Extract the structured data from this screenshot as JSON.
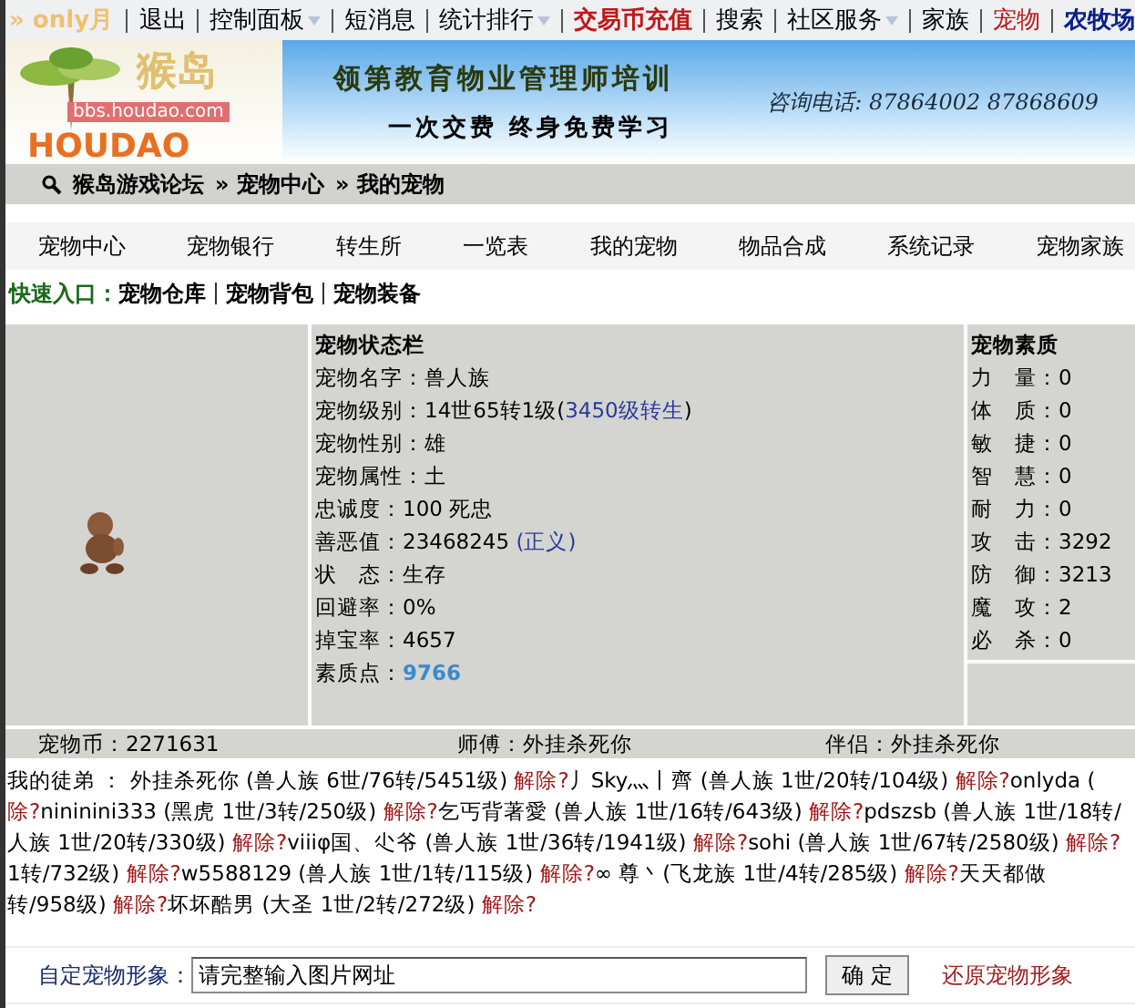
{
  "top_nav": {
    "user": "» only月",
    "items": [
      {
        "label": "退出",
        "kind": "plain",
        "dropdown": false
      },
      {
        "label": "控制面板",
        "kind": "plain",
        "dropdown": true
      },
      {
        "label": "短消息",
        "kind": "plain",
        "dropdown": false
      },
      {
        "label": "统计排行",
        "kind": "plain",
        "dropdown": true
      },
      {
        "label": "交易币充值",
        "kind": "hot",
        "dropdown": false
      },
      {
        "label": "搜索",
        "kind": "plain",
        "dropdown": false
      },
      {
        "label": "社区服务",
        "kind": "plain",
        "dropdown": true
      },
      {
        "label": "家族",
        "kind": "plain",
        "dropdown": false
      },
      {
        "label": "宠物",
        "kind": "red",
        "dropdown": false
      },
      {
        "label": "农牧场",
        "kind": "blue",
        "dropdown": false
      }
    ]
  },
  "logo": {
    "title": "猴岛",
    "url": "bbs.houdao.com",
    "wordmark": "HOUDAO"
  },
  "banner": {
    "headline": "领第教育物业管理师培训",
    "subline": "一次交费 终身免费学习",
    "phone": "咨询电话: 87864002 87868609"
  },
  "breadcrumb": [
    "猴岛游戏论坛",
    "» 宠物中心",
    "» 我的宠物"
  ],
  "tabs": [
    "宠物中心",
    "宠物银行",
    "转生所",
    "一览表",
    "我的宠物",
    "物品合成",
    "系统记录",
    "宠物家族"
  ],
  "quick_entry": {
    "label": "快速入口：",
    "links": [
      "宠物仓库",
      "宠物背包",
      "宠物装备"
    ]
  },
  "status_panel": {
    "title": "宠物状态栏",
    "rows": [
      {
        "label": "宠物名字：",
        "value": "兽人族"
      },
      {
        "label": "宠物级别：",
        "value": "14世65转1级(",
        "link": "3450级转生",
        "after": ")"
      },
      {
        "label": "宠物性别：",
        "value": "雄"
      },
      {
        "label": "宠物属性：",
        "value": "土"
      },
      {
        "label": "忠诚度：",
        "value": "100 死忠"
      },
      {
        "label": "善恶值：",
        "value": "23468245 ",
        "link": "(正义)"
      },
      {
        "label": "状　态：",
        "value": "生存"
      },
      {
        "label": "回避率：",
        "value": "0%"
      },
      {
        "label": "掉宝率：",
        "value": "4657"
      },
      {
        "label": "素质点：",
        "highlight": "9766"
      }
    ]
  },
  "quality_panel": {
    "title": "宠物素质",
    "rows": [
      {
        "label": "力　量：",
        "value": "0"
      },
      {
        "label": "体　质：",
        "value": "0"
      },
      {
        "label": "敏　捷：",
        "value": "0"
      },
      {
        "label": "智　慧：",
        "value": "0"
      },
      {
        "label": "耐　力：",
        "value": "0"
      },
      {
        "label": "攻　击：",
        "value": "3292"
      },
      {
        "label": "防　御：",
        "value": "3213"
      },
      {
        "label": "魔　攻：",
        "value": "2"
      },
      {
        "label": "必　杀：",
        "value": "0"
      }
    ]
  },
  "info_row": [
    "宠物币：2271631",
    "师傅：外挂杀死你",
    "伴侣：外挂杀死你"
  ],
  "disciples": [
    [
      {
        "kind": "text",
        "text": "我的徒弟 ：  外挂杀死你 (兽人族  6世/76转/5451级) "
      },
      {
        "kind": "action",
        "text": "解除?"
      },
      {
        "kind": "text",
        "text": "丿Sky灬丨齊 (兽人族  1世/20转/104级) "
      },
      {
        "kind": "action",
        "text": "解除?"
      },
      {
        "kind": "text",
        "text": "onlyda ("
      }
    ],
    [
      {
        "kind": "action",
        "text": "除?"
      },
      {
        "kind": "text",
        "text": "nininini333 (黑虎  1世/3转/250级) "
      },
      {
        "kind": "action",
        "text": "解除?"
      },
      {
        "kind": "text",
        "text": "乞丐背著愛 (兽人族  1世/16转/643级) "
      },
      {
        "kind": "action",
        "text": "解除?"
      },
      {
        "kind": "text",
        "text": "pdszsb (兽人族  1世/18转/"
      }
    ],
    [
      {
        "kind": "text",
        "text": "人族  1世/20转/330级) "
      },
      {
        "kind": "action",
        "text": "解除?"
      },
      {
        "kind": "text",
        "text": "viiiφ国、尐爷 (兽人族  1世/36转/1941级) "
      },
      {
        "kind": "action",
        "text": "解除?"
      },
      {
        "kind": "text",
        "text": "sohi (兽人族  1世/67转/2580级) "
      },
      {
        "kind": "action",
        "text": "解除?"
      }
    ],
    [
      {
        "kind": "text",
        "text": "1转/732级) "
      },
      {
        "kind": "action",
        "text": "解除?"
      },
      {
        "kind": "text",
        "text": "w5588129 (兽人族  1世/1转/115级) "
      },
      {
        "kind": "action",
        "text": "解除?"
      },
      {
        "kind": "text",
        "text": "∞          尊丶(飞龙族  1世/4转/285级) "
      },
      {
        "kind": "action",
        "text": "解除?"
      },
      {
        "kind": "text",
        "text": "天天都做"
      }
    ],
    [
      {
        "kind": "text",
        "text": "转/958级) "
      },
      {
        "kind": "action",
        "text": "解除?"
      },
      {
        "kind": "text",
        "text": "坏坏酷男 (大圣  1世/2转/272级) "
      },
      {
        "kind": "action",
        "text": "解除?"
      }
    ]
  ],
  "custom_image": {
    "label": "自定宠物形象：",
    "placeholder": "请完整输入图片网址",
    "button": "确 定",
    "reset": "还原宠物形象"
  }
}
